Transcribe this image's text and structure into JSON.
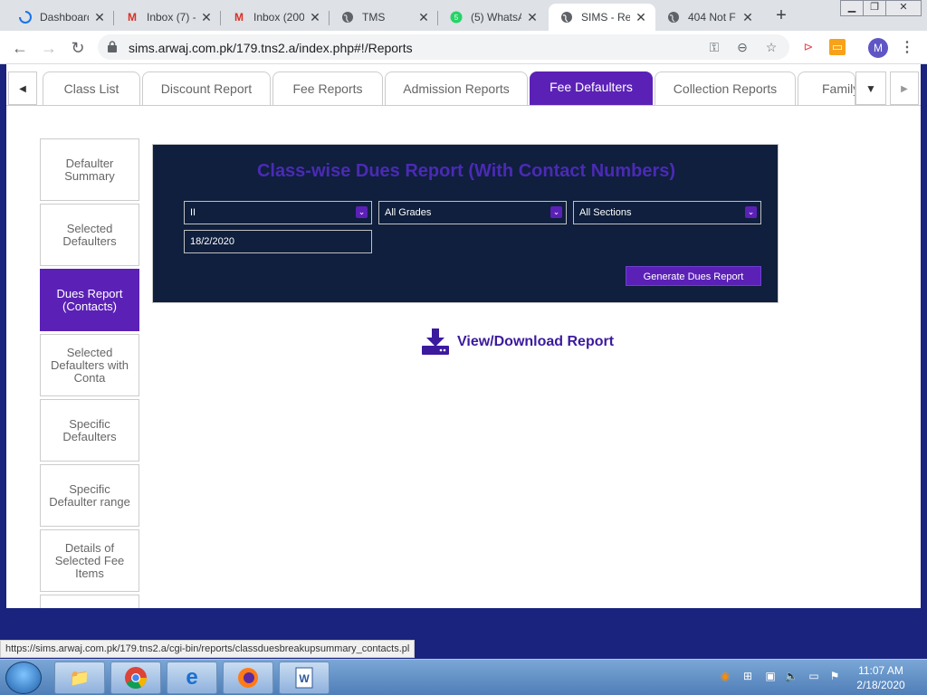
{
  "browser": {
    "tabs": [
      {
        "title": "Dashboard",
        "icon": "loading-icon"
      },
      {
        "title": "Inbox (7) -",
        "icon": "gmail-icon"
      },
      {
        "title": "Inbox (200",
        "icon": "gmail-icon"
      },
      {
        "title": "TMS",
        "icon": "globe-icon"
      },
      {
        "title": "(5) WhatsA",
        "icon": "whatsapp-icon"
      },
      {
        "title": "SIMS - Re",
        "icon": "globe-icon"
      },
      {
        "title": "404 Not F",
        "icon": "globe-icon"
      }
    ],
    "url": "sims.arwaj.com.pk/179.tns2.a/index.php#!/Reports",
    "profile_initial": "M"
  },
  "app": {
    "tabs": [
      "Class List",
      "Discount Report",
      "Fee Reports",
      "Admission Reports",
      "Fee Defaulters",
      "Collection Reports",
      "Family"
    ],
    "active_tab": "Fee Defaulters",
    "sidebar": [
      {
        "label": "Defaulter Summary"
      },
      {
        "label": "Selected Defaulters"
      },
      {
        "label": "Dues Report (Contacts)"
      },
      {
        "label": "Selected Defaulters with Conta"
      },
      {
        "label": "Specific Defaulters"
      },
      {
        "label": "Specific Defaulter range"
      },
      {
        "label": "Details of Selected Fee Items"
      }
    ],
    "active_sidebar": "Dues Report (Contacts)",
    "panel": {
      "title": "Class-wise Dues Report (With Contact Numbers)",
      "class_select": "II",
      "grades_select": "All Grades",
      "sections_select": "All Sections",
      "date": "18/2/2020",
      "generate_label": "Generate Dues Report"
    },
    "download_label": "View/Download Report"
  },
  "status_url": "https://sims.arwaj.com.pk/179.tns2.a/cgi-bin/reports/classduesbreakupsummary_contacts.pl",
  "taskbar": {
    "time": "11:07 AM",
    "date": "2/18/2020"
  },
  "colors": {
    "accent": "#5b21b6",
    "panel_bg": "#0f1f3d",
    "title": "#4b2ab5"
  }
}
